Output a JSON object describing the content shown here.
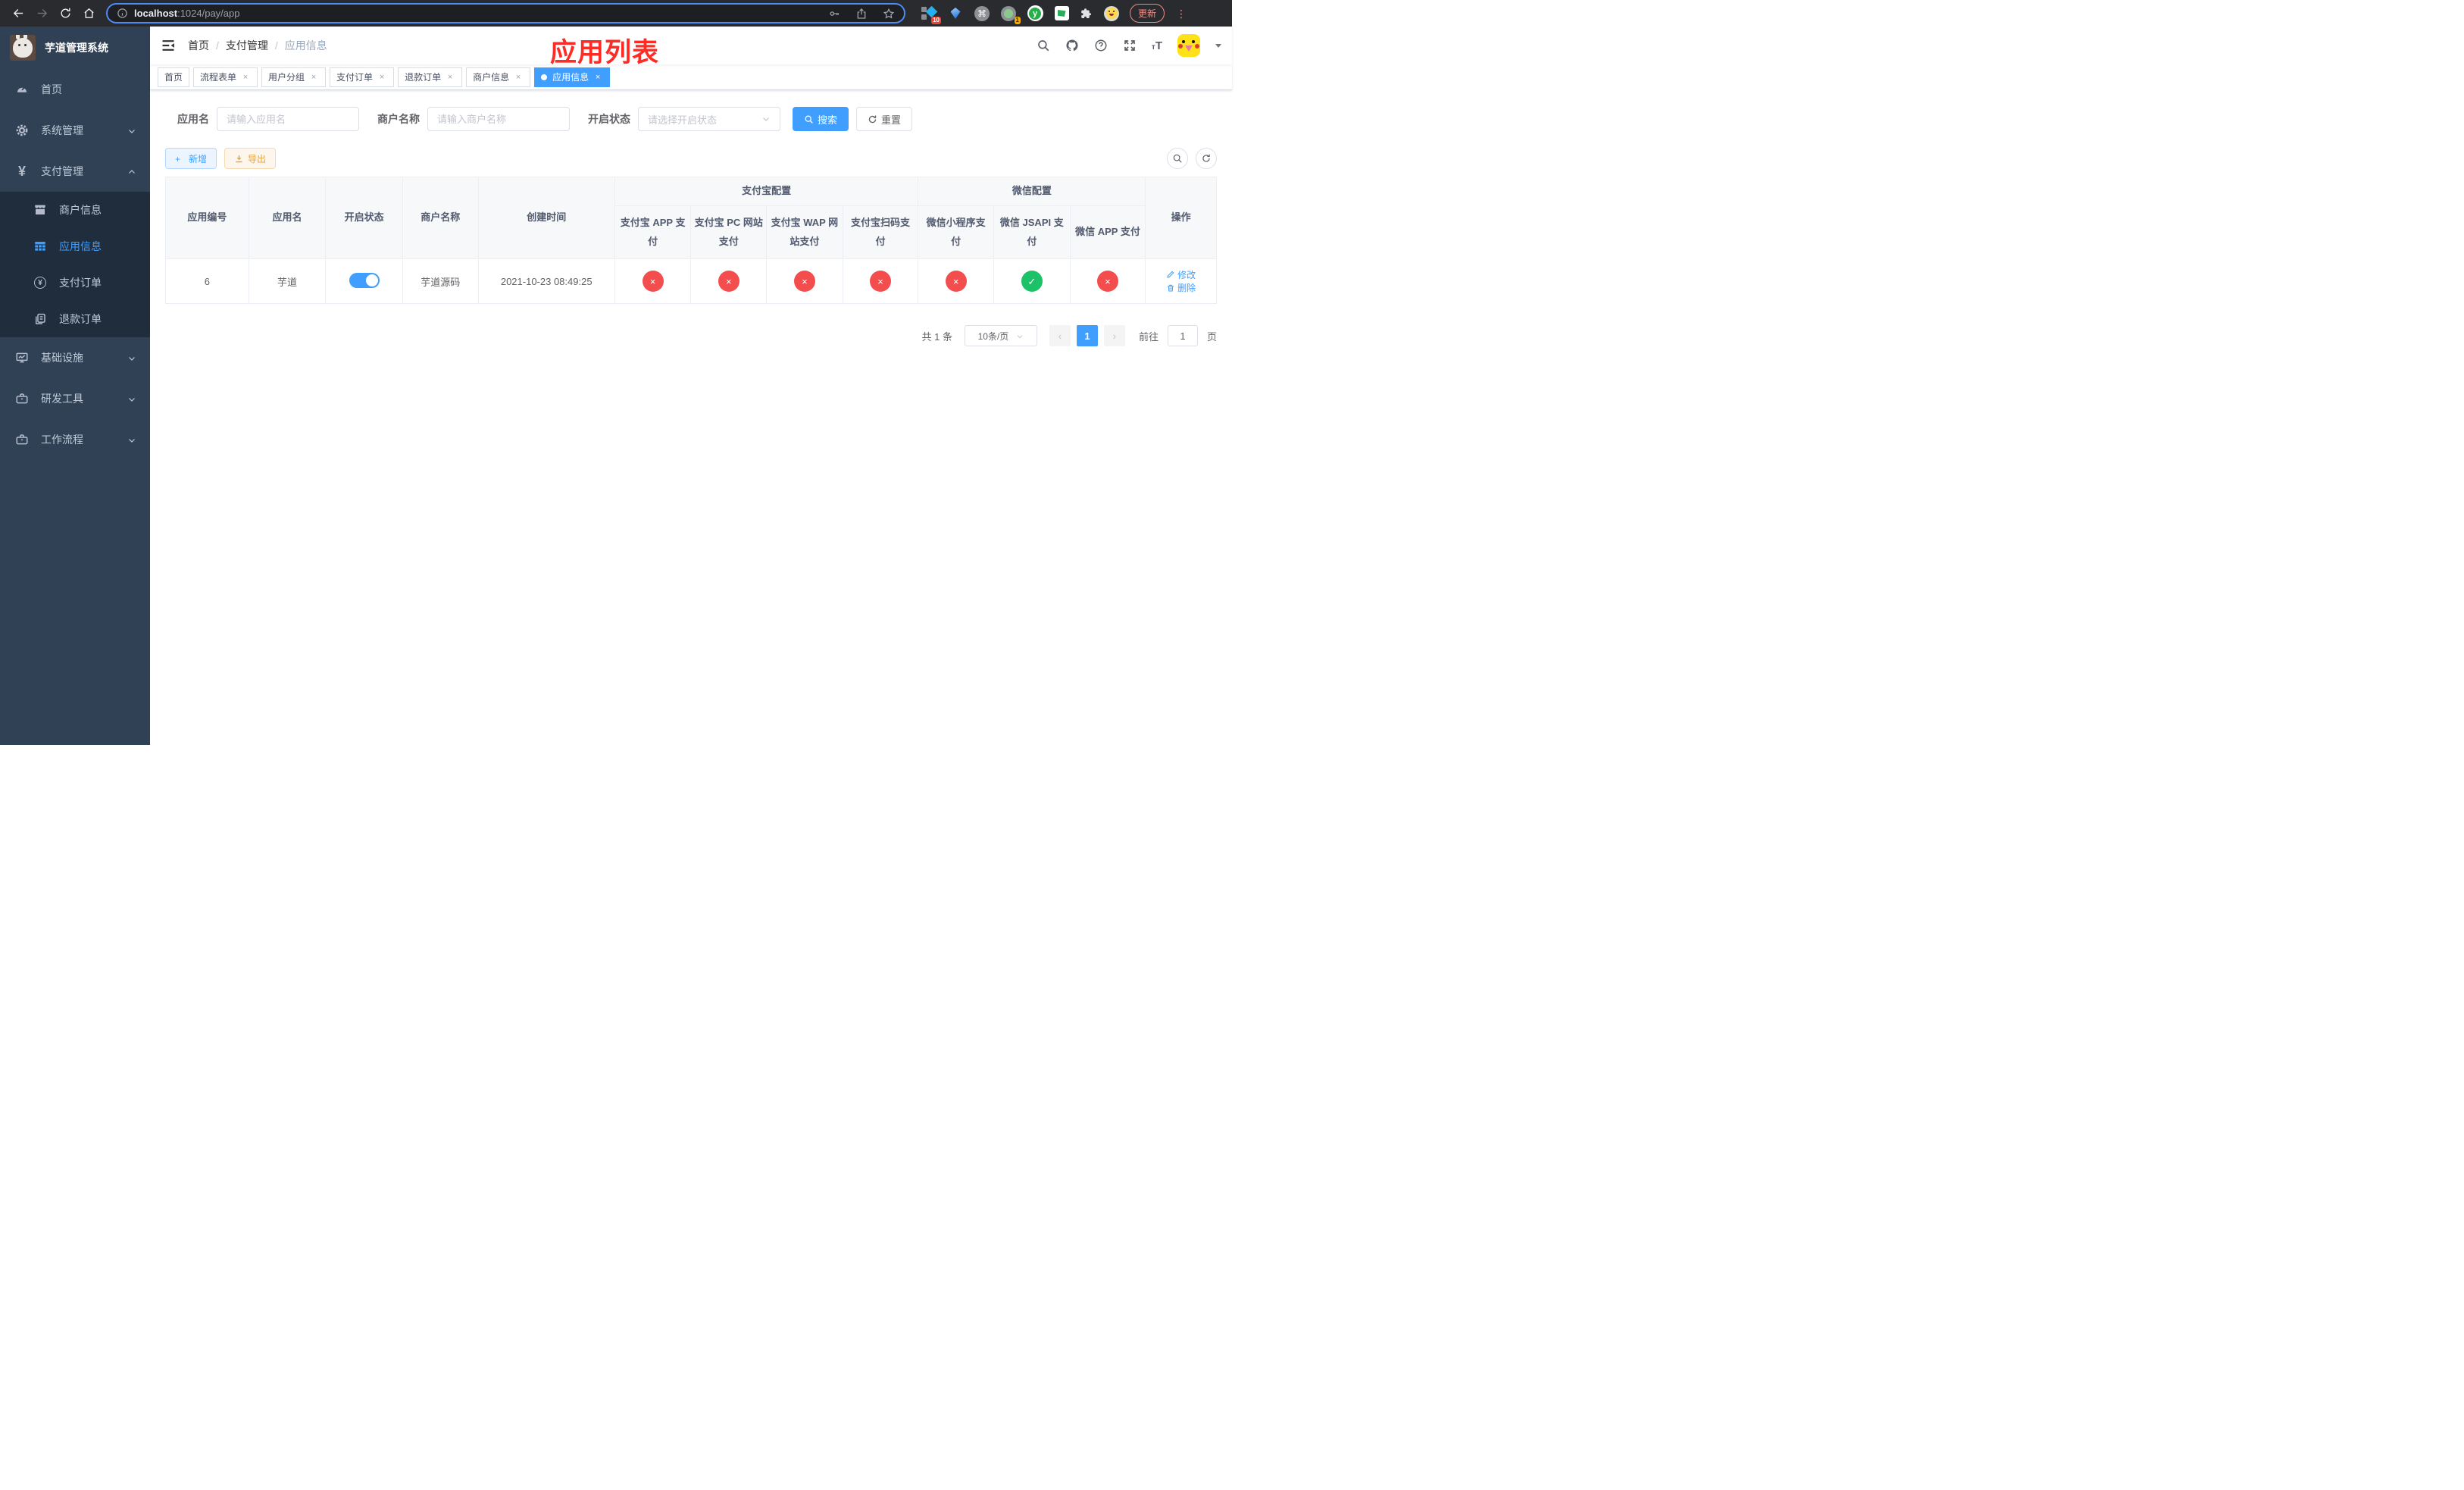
{
  "colors": {
    "accent": "#409eff",
    "success": "#1cc168",
    "danger": "#f34d4d",
    "warning": "#e6a23c",
    "annotation_red": "#fe2c25",
    "sidebar_bg": "#304156",
    "submenu_bg": "#1f2d3d"
  },
  "browser": {
    "url_host": "localhost",
    "url_rest": ":1024/pay/app",
    "ext_badge_1": "10",
    "ext_badge_2": "1",
    "ext_y_label": "y",
    "cmd_glyph": "⌘",
    "update_label": "更新",
    "kebab_glyph": "⋮"
  },
  "sidebar": {
    "title": "芋道管理系统",
    "items": [
      {
        "label": "首页"
      },
      {
        "label": "系统管理"
      },
      {
        "label": "支付管理"
      },
      {
        "label": "商户信息"
      },
      {
        "label": "应用信息"
      },
      {
        "label": "支付订单"
      },
      {
        "label": "退款订单"
      },
      {
        "label": "基础设施"
      },
      {
        "label": "研发工具"
      },
      {
        "label": "工作流程"
      }
    ],
    "yen_glyph": "¥"
  },
  "navbar": {
    "breadcrumb": [
      "首页",
      "支付管理",
      "应用信息"
    ],
    "separator": "/",
    "fontsize_glyph_small": "т",
    "fontsize_glyph_big": "T"
  },
  "annotation": {
    "text": "应用列表"
  },
  "tags": [
    {
      "label": "首页"
    },
    {
      "label": "流程表单"
    },
    {
      "label": "用户分组"
    },
    {
      "label": "支付订单"
    },
    {
      "label": "退款订单"
    },
    {
      "label": "商户信息"
    },
    {
      "label": "应用信息"
    }
  ],
  "close_glyph": "×",
  "search": {
    "app_label": "应用名",
    "app_placeholder": "请输入应用名",
    "merchant_label": "商户名称",
    "merchant_placeholder": "请输入商户名称",
    "status_label": "开启状态",
    "status_placeholder": "请选择开启状态",
    "search_btn": "搜索",
    "reset_btn": "重置"
  },
  "toolbar": {
    "add_label": "新增",
    "add_plus": "+",
    "export_label": "导出"
  },
  "table": {
    "columns": [
      "应用编号",
      "应用名",
      "开启状态",
      "商户名称",
      "创建时间"
    ],
    "groups": [
      {
        "label": "支付宝配置",
        "children": [
          "支付宝 APP 支付",
          "支付宝 PC 网站支付",
          "支付宝 WAP 网站支付",
          "支付宝扫码支付"
        ]
      },
      {
        "label": "微信配置",
        "children": [
          "微信小程序支付",
          "微信 JSAPI 支付",
          "微信 APP 支付"
        ]
      }
    ],
    "actions_header": "操作",
    "row": {
      "id": "6",
      "name": "芋道",
      "enabled": true,
      "merchant": "芋道源码",
      "created_at": "2021-10-23 08:49:25",
      "statuses": [
        "no",
        "no",
        "no",
        "no",
        "no",
        "yes",
        "no"
      ],
      "edit_label": "修改",
      "delete_label": "删除"
    }
  },
  "pagination": {
    "total_label": "共 1 条",
    "page_size": "10条/页",
    "prev_glyph": "‹",
    "current_page": "1",
    "next_glyph": "›",
    "goto_label": "前往",
    "goto_value": "1",
    "page_suffix": "页"
  }
}
